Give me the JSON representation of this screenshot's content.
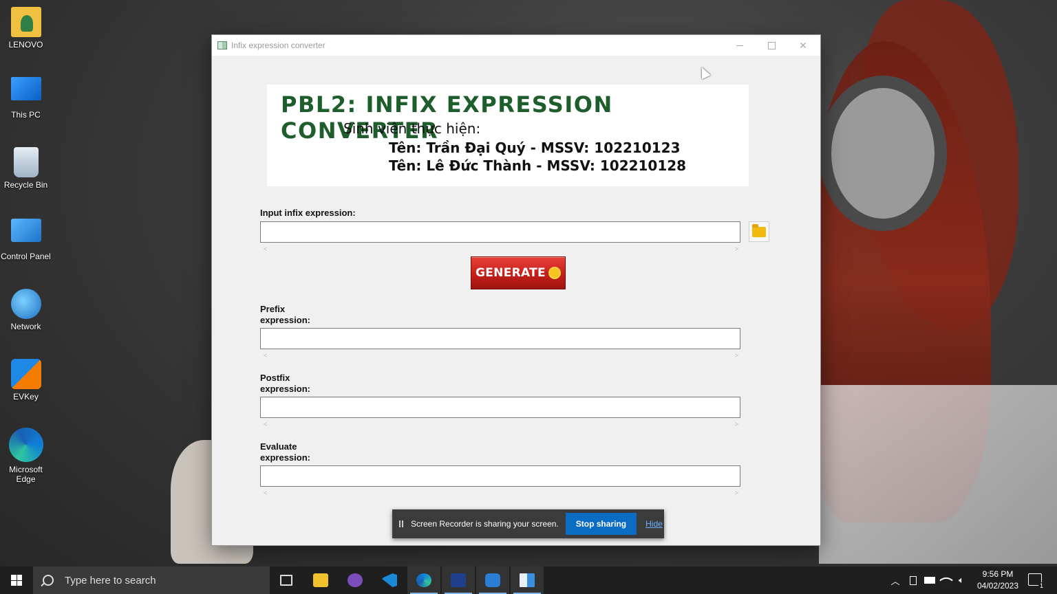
{
  "desktop": {
    "icons": [
      {
        "label": "LENOVO"
      },
      {
        "label": "This PC"
      },
      {
        "label": "Recycle Bin"
      },
      {
        "label": "Control Panel"
      },
      {
        "label": "Network"
      },
      {
        "label": "EVKey"
      },
      {
        "label": "Microsoft Edge"
      }
    ]
  },
  "window": {
    "title": "Infix expression converter",
    "banner": {
      "heading": "PBL2: INFIX EXPRESSION CONVERTER",
      "line1": "Sinh viên thực hiện:",
      "line2": "Tên: Trần Đại Quý - MSSV: 102210123",
      "line3": "Tên: Lê Đức Thành - MSSV: 102210128"
    },
    "input_label": "Input infix expression:",
    "input_value": "",
    "generate_label": "GENERATE",
    "prefix_label": "Prefix expression:",
    "prefix_value": "",
    "postfix_label": "Postfix expression:",
    "postfix_value": "",
    "evaluate_label": "Evaluate expression:",
    "evaluate_value": "",
    "scroll_left": "<",
    "scroll_right": ">"
  },
  "share_bar": {
    "message": "Screen Recorder is sharing your screen.",
    "stop_label": "Stop sharing",
    "hide_label": "Hide"
  },
  "taskbar": {
    "search_placeholder": "Type here to search",
    "time": "9:56 PM",
    "date": "04/02/2023",
    "notification_count": "1",
    "apps": [
      "task-view",
      "file-explorer",
      "github-desktop",
      "vscode",
      "edge",
      "dev-cpp",
      "screen-recorder",
      "app-window"
    ]
  },
  "colors": {
    "banner_heading": "#1e5e2c",
    "generate_button": "#c3201a",
    "stop_sharing": "#0b6cc4",
    "taskbar": "#1f1f1f"
  }
}
